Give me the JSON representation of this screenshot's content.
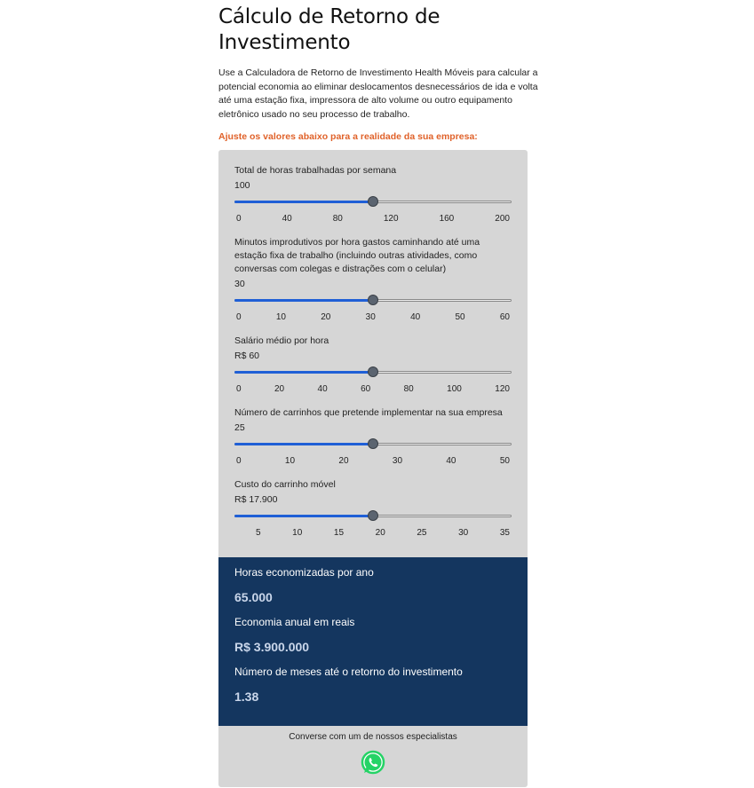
{
  "header": {
    "title": "Cálculo de Retorno de Investimento",
    "intro": "Use a Calculadora de Retorno de Investimento Health Móveis para calcular a potencial economia ao eliminar deslocamentos desnecessários de ida e volta até uma estação fixa, impressora de alto volume ou outro equipamento eletrônico usado no seu processo de trabalho.",
    "note": "Ajuste os valores abaixo para a realidade da sua empresa:"
  },
  "sliders": [
    {
      "label": "Total de horas trabalhadas por semana",
      "value_text": "100",
      "value": 100,
      "min": 0,
      "max": 200,
      "ticks": [
        "0",
        "40",
        "80",
        "120",
        "160",
        "200"
      ]
    },
    {
      "label": "Minutos improdutivos por hora gastos caminhando até uma estação fixa de trabalho (incluindo outras atividades, como conversas com colegas e distrações com o celular)",
      "value_text": "30",
      "value": 30,
      "min": 0,
      "max": 60,
      "ticks": [
        "0",
        "10",
        "20",
        "30",
        "40",
        "50",
        "60"
      ]
    },
    {
      "label": "Salário médio por hora",
      "value_text": "R$ 60",
      "value": 60,
      "min": 0,
      "max": 120,
      "ticks": [
        "0",
        "20",
        "40",
        "60",
        "80",
        "100",
        "120"
      ]
    },
    {
      "label": "Número de carrinhos que pretende implementar na sua empresa",
      "value_text": "25",
      "value": 25,
      "min": 0,
      "max": 50,
      "ticks": [
        "0",
        "10",
        "20",
        "30",
        "40",
        "50"
      ]
    },
    {
      "label": "Custo do carrinho móvel",
      "value_text": "R$ 17.900",
      "value": 0.5,
      "min": 0,
      "max": 1,
      "ticks": [
        "5",
        "10",
        "15",
        "20",
        "25",
        "30",
        "35"
      ]
    }
  ],
  "results": [
    {
      "label": "Horas economizadas por ano",
      "value": "65.000"
    },
    {
      "label": "Economia anual em reais",
      "value": "R$ 3.900.000"
    },
    {
      "label": "Número de meses até o retorno do investimento",
      "value": "1.38"
    }
  ],
  "footer": {
    "text": "Converse com um de nossos especialistas",
    "icon": "whatsapp-icon"
  },
  "colors": {
    "accent": "#1f5fd6",
    "note": "#e0622a",
    "results_bg": "#14365f",
    "panel_bg": "#d6d6d6"
  }
}
